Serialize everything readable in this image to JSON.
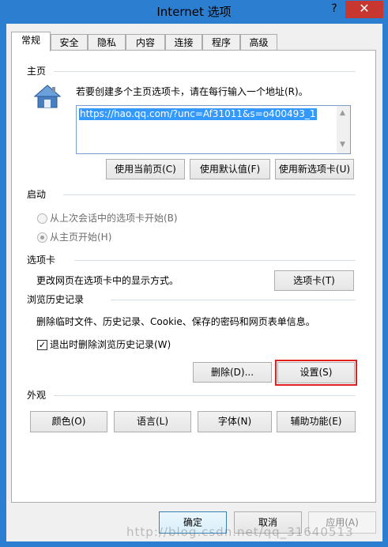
{
  "window": {
    "title": "Internet 选项",
    "help_glyph": "?",
    "close_glyph": "✕"
  },
  "tabs": [
    {
      "label": "常规"
    },
    {
      "label": "安全"
    },
    {
      "label": "隐私"
    },
    {
      "label": "内容"
    },
    {
      "label": "连接"
    },
    {
      "label": "程序"
    },
    {
      "label": "高级"
    }
  ],
  "home": {
    "section_title": "主页",
    "instruction": "若要创建多个主页选项卡，请在每行输入一个地址(R)。",
    "url_value": "https://hao.qq.com/?unc=Af31011&s=o400493_1",
    "buttons": {
      "use_current": "使用当前页(C)",
      "use_default": "使用默认值(F)",
      "use_new_tab": "使用新选项卡(U)"
    }
  },
  "startup": {
    "section_title": "启动",
    "option_last_session": "从上次会话中的选项卡开始(B)",
    "option_home": "从主页开始(H)",
    "selected": "option_home"
  },
  "tabs_section": {
    "section_title": "选项卡",
    "description": "更改网页在选项卡中的显示方式。",
    "button": "选项卡(T)"
  },
  "history": {
    "section_title": "浏览历史记录",
    "description": "删除临时文件、历史记录、Cookie、保存的密码和网页表单信息。",
    "checkbox_label": "退出时删除浏览历史记录(W)",
    "checkbox_checked": true,
    "delete_button": "删除(D)...",
    "settings_button": "设置(S)"
  },
  "appearance": {
    "section_title": "外观",
    "buttons": {
      "colors": "颜色(O)",
      "languages": "语言(L)",
      "fonts": "字体(N)",
      "accessibility": "辅助功能(E)"
    }
  },
  "footer": {
    "ok": "确定",
    "cancel": "取消",
    "apply": "应用(A)"
  },
  "watermark": "http://blog.csdn.net/qq_31640513",
  "colors": {
    "title_bar": "#2c7fd0",
    "close_button": "#c7372f",
    "highlight_frame": "#e02020",
    "selection": "#3399ff"
  }
}
